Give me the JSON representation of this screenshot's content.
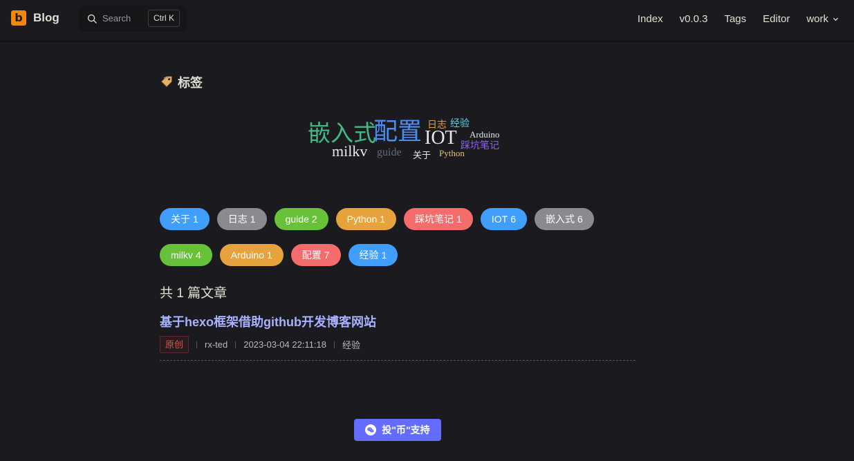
{
  "navbar": {
    "logo_letter": "b",
    "logo_text": "Blog",
    "search_placeholder": "Search",
    "search_shortcut": "Ctrl K",
    "links": [
      {
        "label": "Index"
      },
      {
        "label": "v0.0.3"
      },
      {
        "label": "Tags"
      },
      {
        "label": "Editor"
      },
      {
        "label": "work",
        "has_dropdown": true
      }
    ]
  },
  "page": {
    "title": "标签"
  },
  "word_cloud": [
    {
      "text": "嵌入式",
      "color": "#42b883"
    },
    {
      "text": "配置",
      "color": "#4d8cf5"
    },
    {
      "text": "日志",
      "color": "#e6a23c"
    },
    {
      "text": "经验",
      "color": "#5ad1e6"
    },
    {
      "text": "IOT",
      "color": "#e8e8e8"
    },
    {
      "text": "Arduino",
      "color": "#e8e8e8"
    },
    {
      "text": "踩坑笔记",
      "color": "#8a63e8"
    },
    {
      "text": "milkv",
      "color": "#e8e8e8"
    },
    {
      "text": "guide",
      "color": "#5f6b7a"
    },
    {
      "text": "关于",
      "color": "#e8e8e8"
    },
    {
      "text": "Python",
      "color": "#e6c46e"
    }
  ],
  "tags": [
    {
      "name": "关于",
      "count": "1",
      "color": "#409eff"
    },
    {
      "name": "日志",
      "count": "1",
      "color": "#8a8a90"
    },
    {
      "name": "guide",
      "count": "2",
      "color": "#67c23a"
    },
    {
      "name": "Python",
      "count": "1",
      "color": "#e6a23c"
    },
    {
      "name": "踩坑笔记",
      "count": "1",
      "color": "#f56c6c"
    },
    {
      "name": "IOT",
      "count": "6",
      "color": "#409eff"
    },
    {
      "name": "嵌入式",
      "count": "6",
      "color": "#8a8a90"
    },
    {
      "name": "milkv",
      "count": "4",
      "color": "#67c23a"
    },
    {
      "name": "Arduino",
      "count": "1",
      "color": "#e6a23c"
    },
    {
      "name": "配置",
      "count": "7",
      "color": "#f56c6c"
    },
    {
      "name": "经验",
      "count": "1",
      "color": "#409eff"
    }
  ],
  "articles": {
    "count_text": "共 1 篇文章",
    "items": [
      {
        "title": "基于hexo框架借助github开发博客网站",
        "badge": "原创",
        "author": "rx-ted",
        "datetime": "2023-03-04 22:11:18",
        "tag": "经验"
      }
    ]
  },
  "footer": {
    "support_label": "投\"币\"支持"
  }
}
